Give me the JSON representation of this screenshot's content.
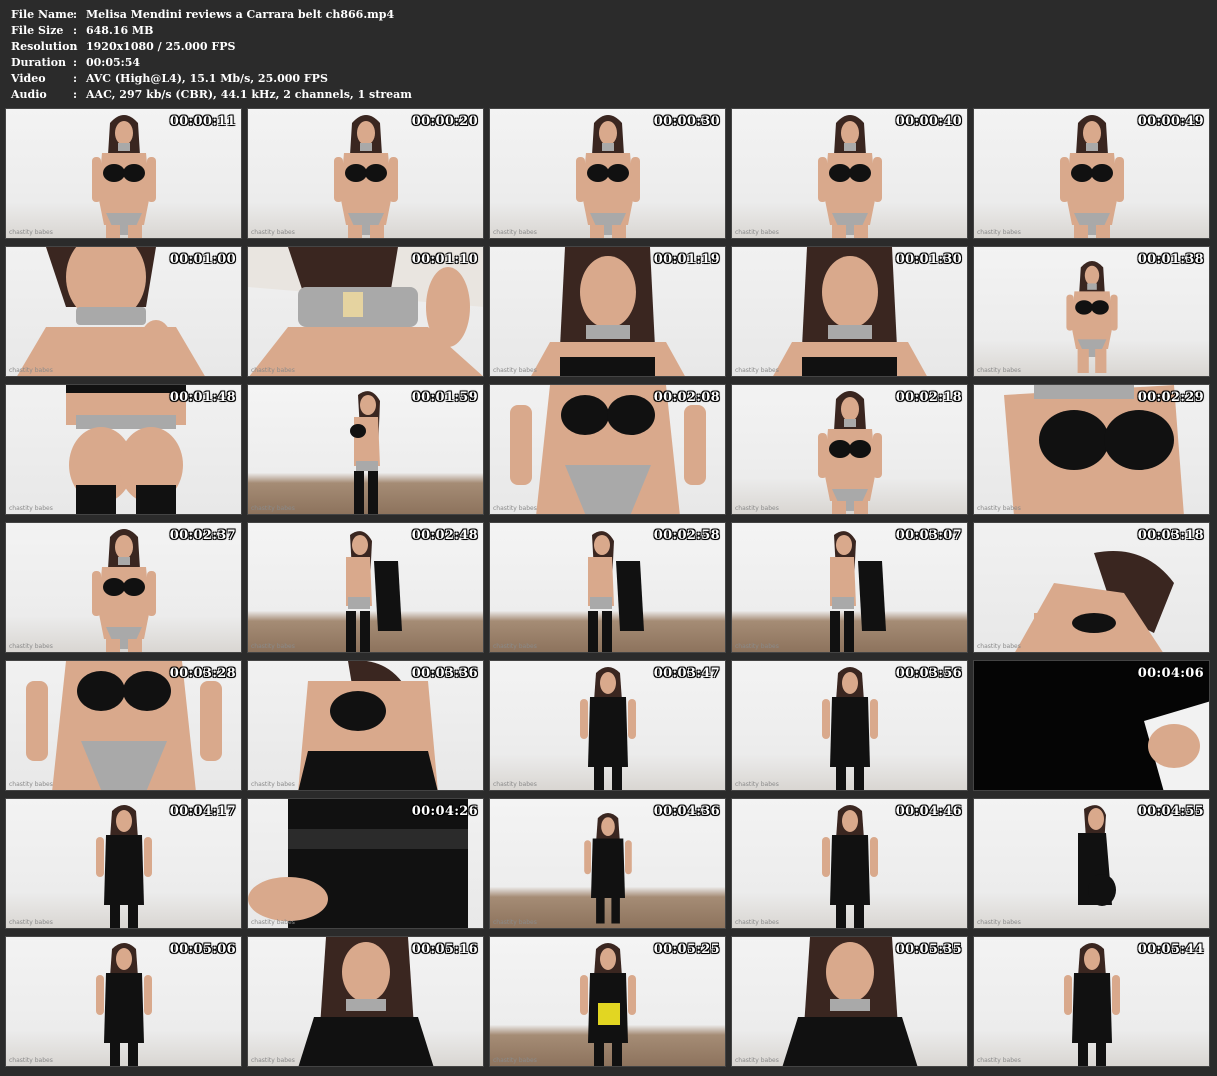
{
  "info": [
    {
      "key": "File Name",
      "value": "Melisa Mendini reviews a Carrara belt ch866.mp4"
    },
    {
      "key": "File Size",
      "value": "648.16 MB"
    },
    {
      "key": "Resolution",
      "value": "1920x1080 / 25.000 FPS"
    },
    {
      "key": "Duration",
      "value": "00:05:54"
    },
    {
      "key": "Video",
      "value": "AVC (High@L4), 15.1 Mb/s, 25.000 FPS"
    },
    {
      "key": "Audio",
      "value": "AAC, 297 kb/s (CBR), 44.1 kHz, 2 channels, 1 stream"
    }
  ],
  "separator": ":",
  "thumbnails": [
    {
      "time": "00:00:11",
      "scene": "lingerie-full"
    },
    {
      "time": "00:00:20",
      "scene": "lingerie-full"
    },
    {
      "time": "00:00:30",
      "scene": "lingerie-full"
    },
    {
      "time": "00:00:40",
      "scene": "lingerie-full"
    },
    {
      "time": "00:00:49",
      "scene": "lingerie-full"
    },
    {
      "time": "00:01:00",
      "scene": "collar-closeup"
    },
    {
      "time": "00:01:10",
      "scene": "collar-back"
    },
    {
      "time": "00:01:19",
      "scene": "portrait-dark"
    },
    {
      "time": "00:01:30",
      "scene": "portrait-dark"
    },
    {
      "time": "00:01:38",
      "scene": "lingerie-small"
    },
    {
      "time": "00:01:48",
      "scene": "rear-belt"
    },
    {
      "time": "00:01:59",
      "scene": "side-lingerie"
    },
    {
      "time": "00:02:08",
      "scene": "torso-belt"
    },
    {
      "time": "00:02:18",
      "scene": "lingerie-full"
    },
    {
      "time": "00:02:29",
      "scene": "torso-lean"
    },
    {
      "time": "00:02:37",
      "scene": "lingerie-full"
    },
    {
      "time": "00:02:48",
      "scene": "dressing"
    },
    {
      "time": "00:02:58",
      "scene": "dressing"
    },
    {
      "time": "00:03:07",
      "scene": "dressing"
    },
    {
      "time": "00:03:18",
      "scene": "bending"
    },
    {
      "time": "00:03:28",
      "scene": "torso-belt"
    },
    {
      "time": "00:03:36",
      "scene": "dressing-close"
    },
    {
      "time": "00:03:47",
      "scene": "dress-full"
    },
    {
      "time": "00:03:56",
      "scene": "dress-full"
    },
    {
      "time": "00:04:06",
      "scene": "dark-hand"
    },
    {
      "time": "00:04:17",
      "scene": "dress-full"
    },
    {
      "time": "00:04:26",
      "scene": "dress-closeup"
    },
    {
      "time": "00:04:36",
      "scene": "dress-small"
    },
    {
      "time": "00:04:46",
      "scene": "dress-full"
    },
    {
      "time": "00:04:55",
      "scene": "dress-side"
    },
    {
      "time": "00:05:06",
      "scene": "dress-full"
    },
    {
      "time": "00:05:16",
      "scene": "dress-portrait"
    },
    {
      "time": "00:05:25",
      "scene": "dress-ball"
    },
    {
      "time": "00:05:35",
      "scene": "dress-portrait"
    },
    {
      "time": "00:05:44",
      "scene": "dress-full"
    }
  ],
  "watermark": "chastity babes",
  "colors": {
    "background": "#2b2b2b",
    "text": "#ffffff",
    "skin": "#d9a98c",
    "hair": "#3a2620",
    "garment": "#111111",
    "metal": "#a9a9a9"
  }
}
